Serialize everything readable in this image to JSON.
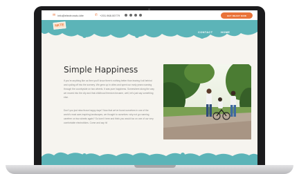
{
  "contact": {
    "email": "info@electronutu.kite",
    "phone": "+201.968.00779"
  },
  "header": {
    "cta_label": "GET READY NOW",
    "logo_text": "NKTE",
    "nav": [
      "CONTACT",
      "HOME"
    ]
  },
  "main": {
    "title": "Simple Happiness",
    "paragraph_1": "If you're anything like us then you'll know there's nothing better than leaving it all behind and cycling off into the scenery. We grew up in cities and spent our early years roaming through the countryside on two wheels. It was pure happiness. Somewhere along the way we moved into the city and that childhood freedom became, well, let's just say something else.",
    "paragraph_2": "Don't you just miss those happy days? Now that we've found ourselves in one of the world's most awe-inspiring landscapes, we thought to ourselves: why not go roaming carefree on two wheels again? So love it here and think you would too on one of our very comfortable electrobikes. Come and say hi!"
  },
  "colors": {
    "accent": "#e9733a",
    "teal": "#5cb4b8",
    "background": "#f6f4ef"
  },
  "icons": {
    "email": "mail-icon",
    "phone": "phone-icon",
    "socials": [
      "facebook-icon",
      "twitter-icon",
      "instagram-icon",
      "pinterest-icon"
    ]
  }
}
